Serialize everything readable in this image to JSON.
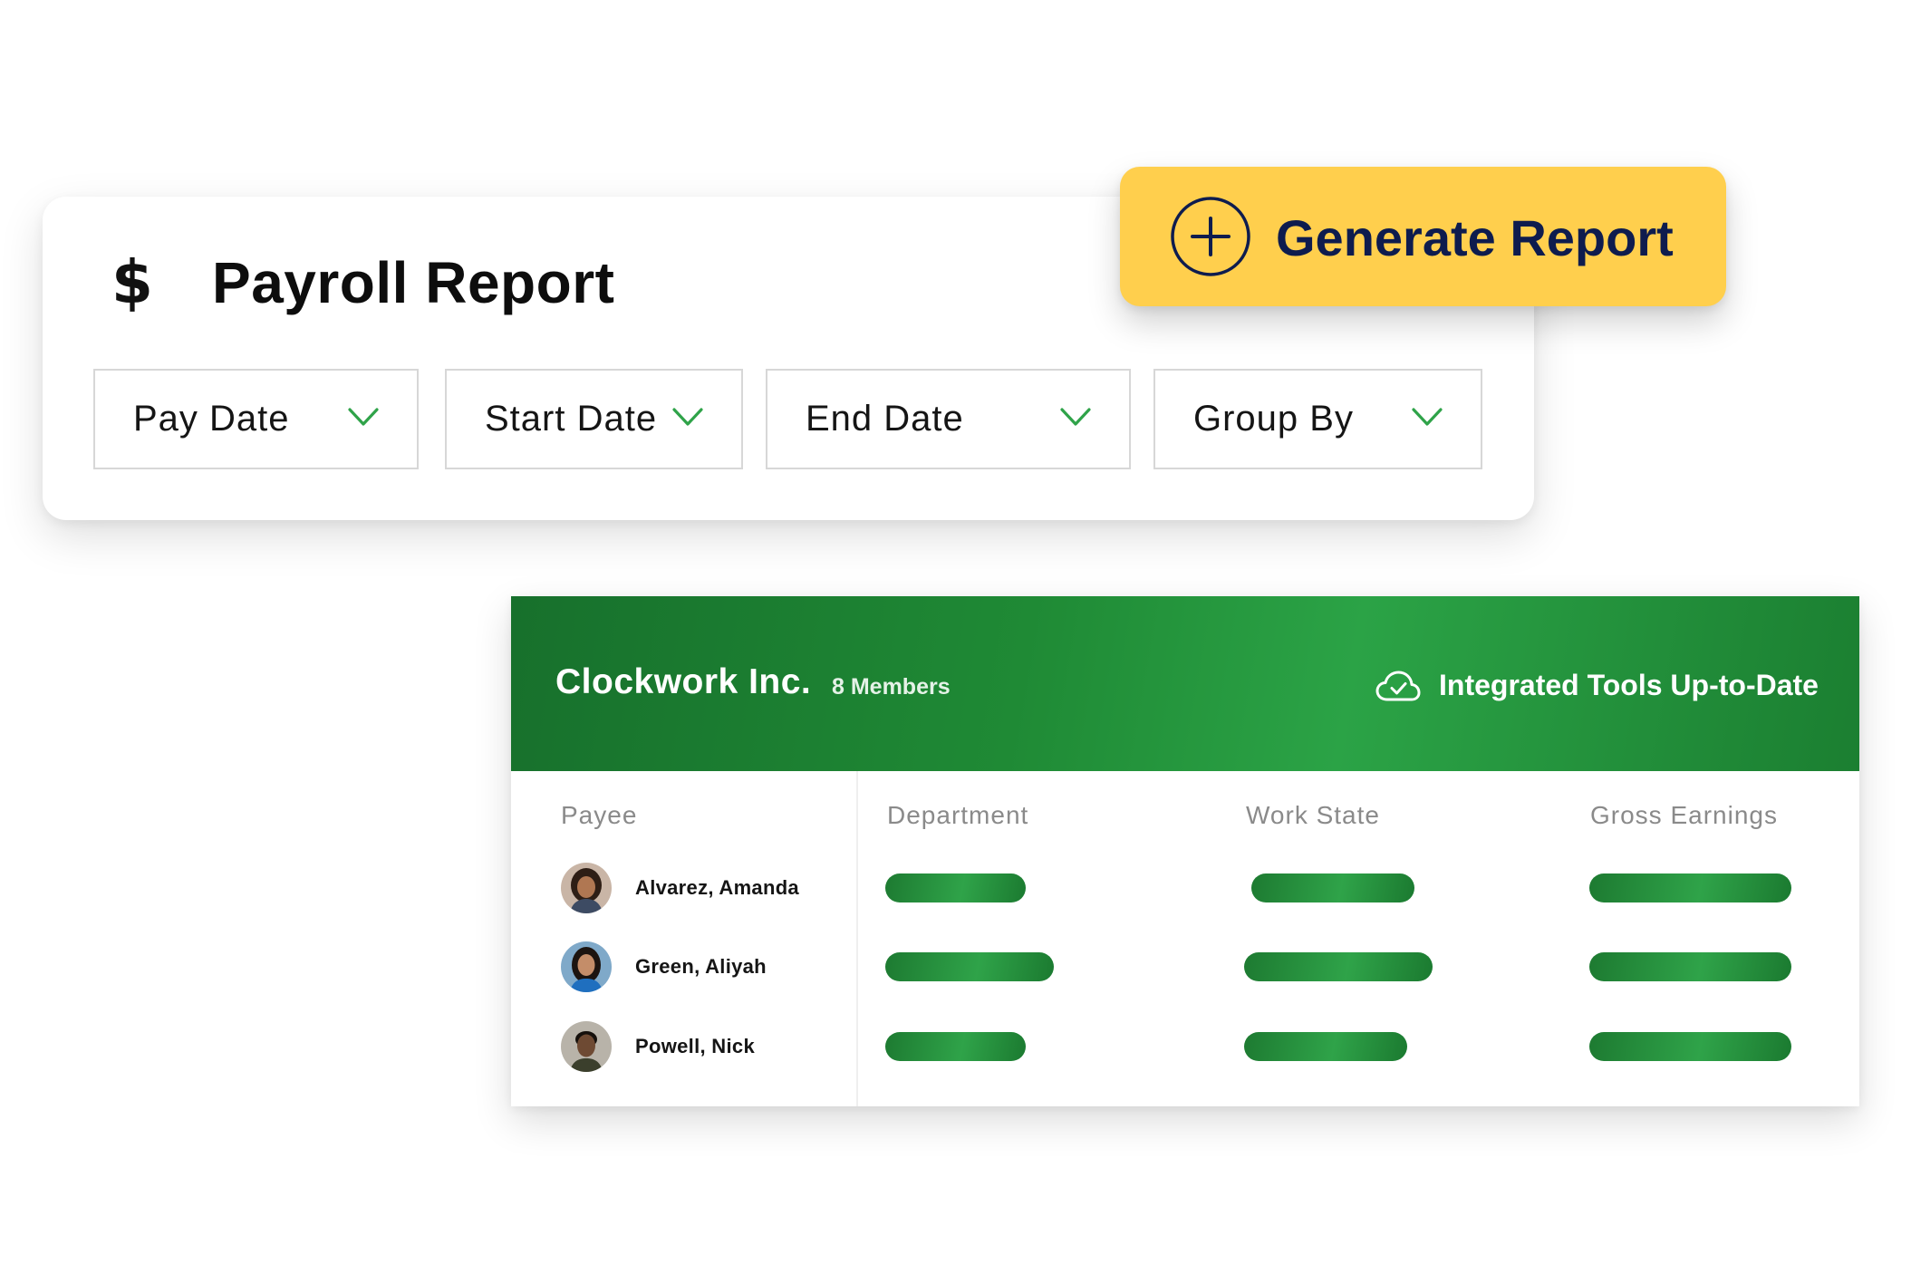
{
  "report": {
    "icon": "dollar-icon",
    "icon_glyph": "$",
    "title": "Payroll Report",
    "filters": [
      {
        "label": "Pay Date"
      },
      {
        "label": "Start Date"
      },
      {
        "label": "End Date"
      },
      {
        "label": "Group By"
      }
    ]
  },
  "generate_button": {
    "icon": "plus-circle-icon",
    "label": "Generate Report",
    "color": "#ffcf4d",
    "text_color": "#0e1c4e"
  },
  "team": {
    "company": "Clockwork Inc.",
    "members": "8 Members",
    "sync_icon": "cloud-check-icon",
    "sync_status": "Integrated Tools Up-to-Date",
    "header_color": "#1f8a35",
    "columns": [
      "Payee",
      "Department",
      "Work State",
      "Gross Earnings"
    ],
    "rows": [
      {
        "name": "Alvarez, Amanda",
        "avatar": "avatar-photo"
      },
      {
        "name": "Green, Aliyah",
        "avatar": "avatar-photo"
      },
      {
        "name": "Powell, Nick",
        "avatar": "avatar-photo"
      }
    ]
  },
  "colors": {
    "accent_green": "#2ba346",
    "chevron_green": "#2fa349"
  }
}
